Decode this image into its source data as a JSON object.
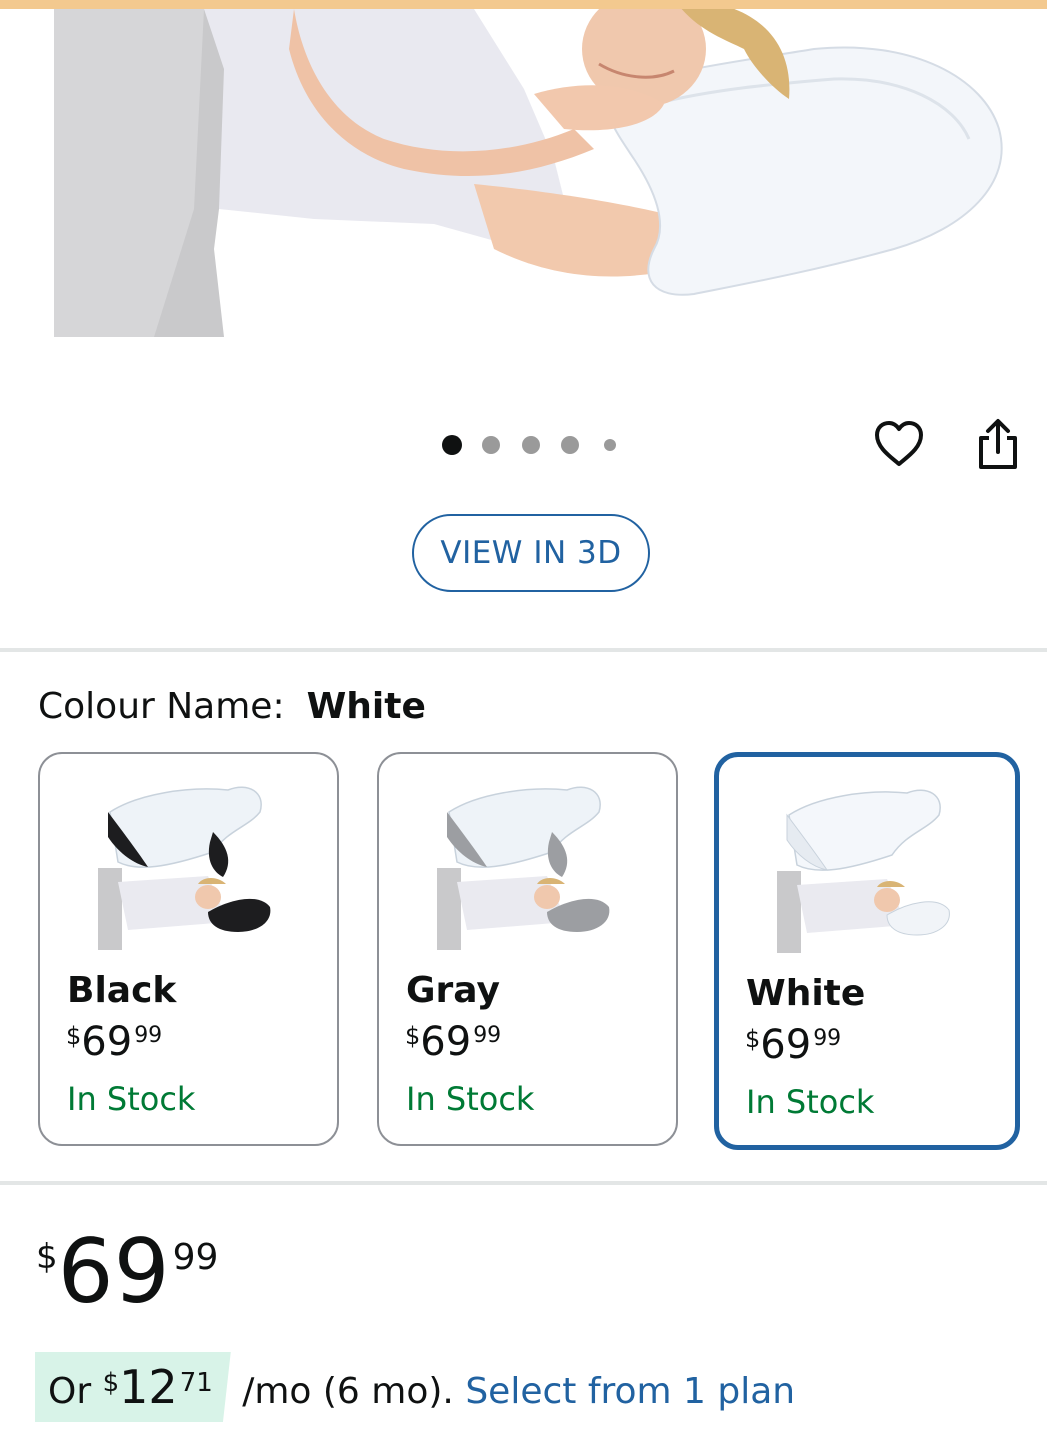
{
  "gallery": {
    "image_alt": "Woman resting on white contour memory foam pillow",
    "dots_count": 5,
    "active_dot": 1,
    "icons": {
      "wishlist": "heart-icon",
      "share": "share-icon"
    },
    "view_3d_label": "VIEW IN 3D"
  },
  "colour": {
    "label": "Colour Name:",
    "selected": "White",
    "options": [
      {
        "name": "Black",
        "currency": "$",
        "whole": "69",
        "fraction": "99",
        "stock": "In Stock",
        "selected": false
      },
      {
        "name": "Gray",
        "currency": "$",
        "whole": "69",
        "fraction": "99",
        "stock": "In Stock",
        "selected": false
      },
      {
        "name": "White",
        "currency": "$",
        "whole": "69",
        "fraction": "99",
        "stock": "In Stock",
        "selected": true
      }
    ]
  },
  "price": {
    "currency": "$",
    "whole": "69",
    "fraction": "99"
  },
  "installment": {
    "prefix": "Or ",
    "currency": "$",
    "whole": "12",
    "fraction": "71",
    "term": " /mo (6 mo). ",
    "link": "Select from 1 plan"
  },
  "colors": {
    "link_blue": "#2162a1",
    "stock_green": "#007a35",
    "chip_green": "#d8f3e8",
    "accent_strip": "#f3c98f"
  }
}
